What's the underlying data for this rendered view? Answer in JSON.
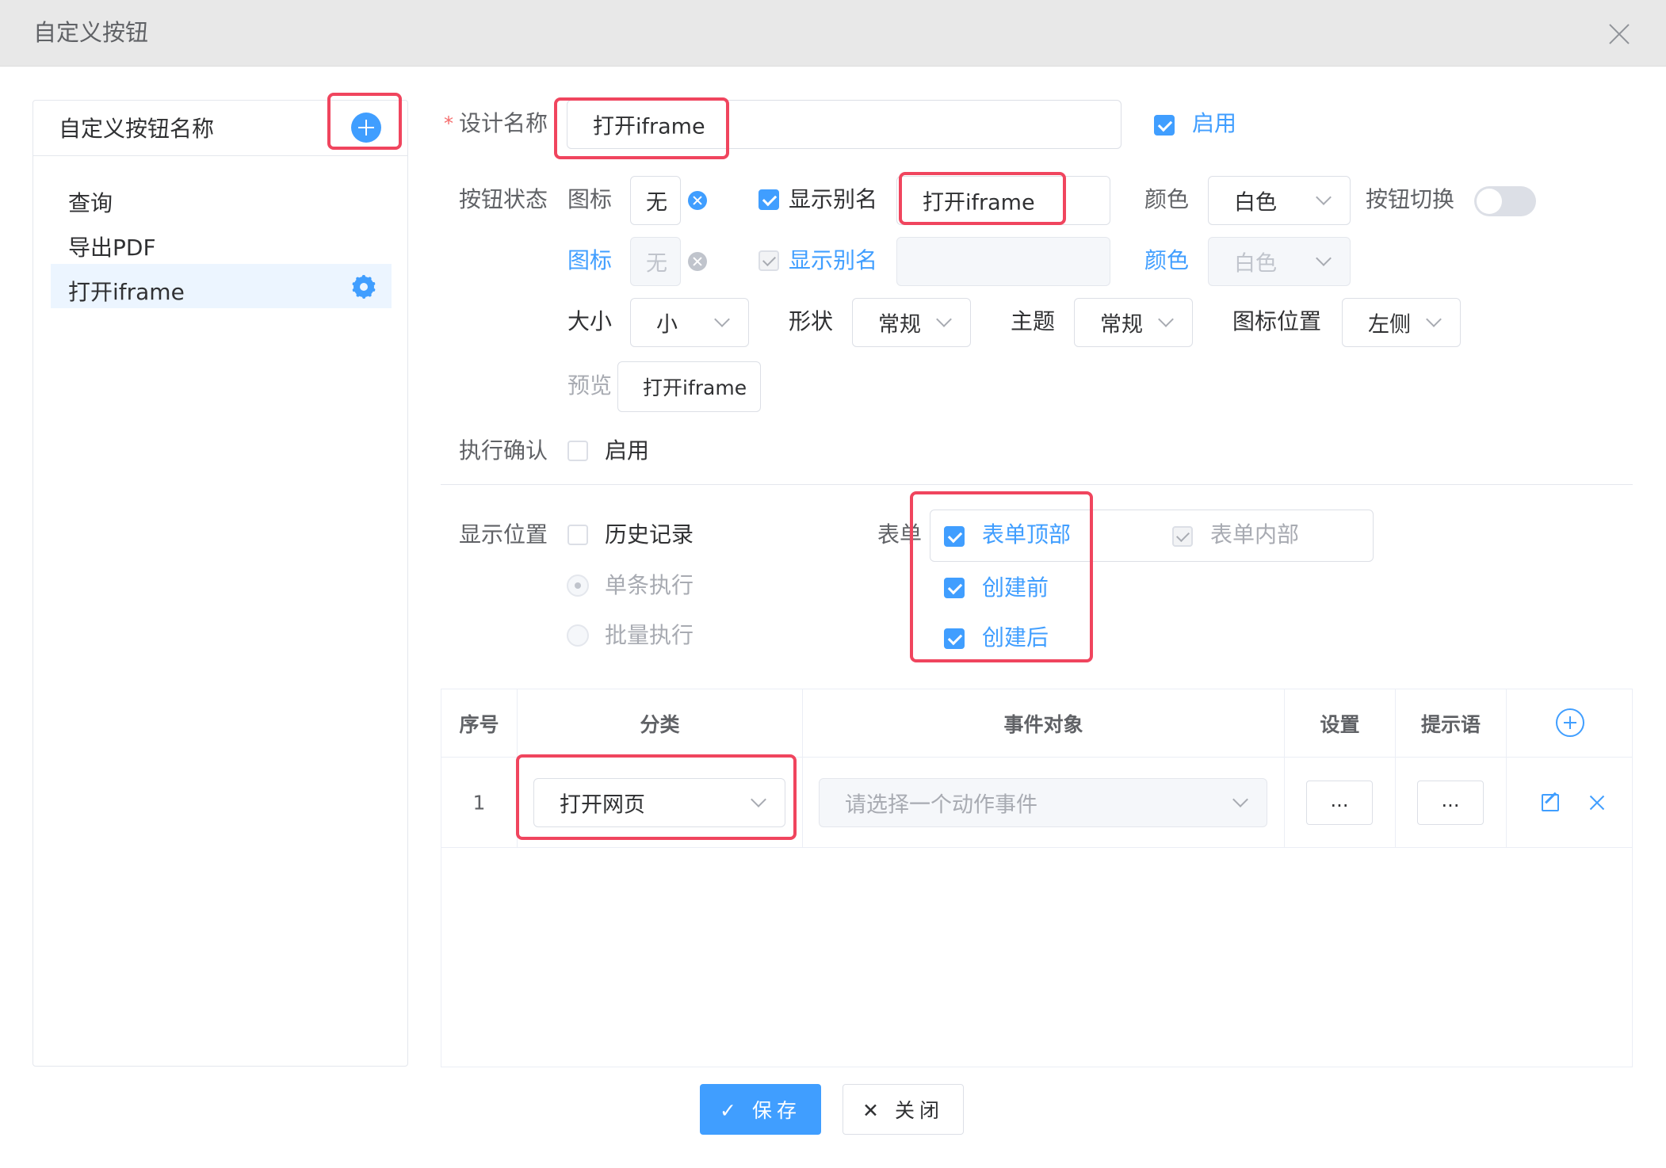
{
  "dialog": {
    "title": "自定义按钮"
  },
  "left_panel": {
    "title": "自定义按钮名称",
    "items": [
      {
        "label": "查询"
      },
      {
        "label": "导出PDF"
      },
      {
        "label": "打开iframe"
      }
    ]
  },
  "form": {
    "design_name": {
      "label": "设计名称",
      "required_mark": "*",
      "value": "打开iframe"
    },
    "enable": {
      "label": "启用",
      "checked": true
    },
    "button_state": {
      "label": "按钮状态",
      "row1": {
        "icon_label": "图标",
        "icon_value": "无",
        "alias_label": "显示别名",
        "alias_checked": true,
        "alias_value": "打开iframe",
        "color_label": "颜色",
        "color_value": "白色",
        "toggle_label": "按钮切换",
        "toggle_on": false
      },
      "row2": {
        "icon_label": "图标",
        "icon_value": "无",
        "alias_label": "显示别名",
        "alias_value": "",
        "color_label": "颜色",
        "color_value": "白色"
      },
      "size": {
        "label": "大小",
        "value": "小"
      },
      "shape": {
        "label": "形状",
        "value": "常规"
      },
      "theme": {
        "label": "主题",
        "value": "常规"
      },
      "icon_position": {
        "label": "图标位置",
        "value": "左侧"
      },
      "preview": {
        "label": "预览",
        "button_text": "打开iframe"
      }
    },
    "confirm": {
      "label": "执行确认",
      "option": "启用",
      "checked": false
    },
    "display_position": {
      "label": "显示位置",
      "history": {
        "label": "历史记录",
        "checked": false
      },
      "single": {
        "label": "单条执行",
        "selected": true
      },
      "batch": {
        "label": "批量执行",
        "selected": false
      },
      "form_label": "表单",
      "form_top": {
        "label": "表单顶部",
        "checked": true
      },
      "form_inner": {
        "label": "表单内部",
        "checked": true
      },
      "before_create": {
        "label": "创建前",
        "checked": true
      },
      "after_create": {
        "label": "创建后",
        "checked": true
      }
    }
  },
  "table": {
    "headers": [
      "序号",
      "分类",
      "事件对象",
      "设置",
      "提示语"
    ],
    "rows": [
      {
        "index": "1",
        "category": "打开网页",
        "event_placeholder": "请选择一个动作事件",
        "settings": "...",
        "tip": "..."
      }
    ]
  },
  "footer": {
    "save": "✓ 保存",
    "close": "✕ 关闭"
  },
  "colors": {
    "primary": "#409eff",
    "highlight": "#f0455e"
  }
}
